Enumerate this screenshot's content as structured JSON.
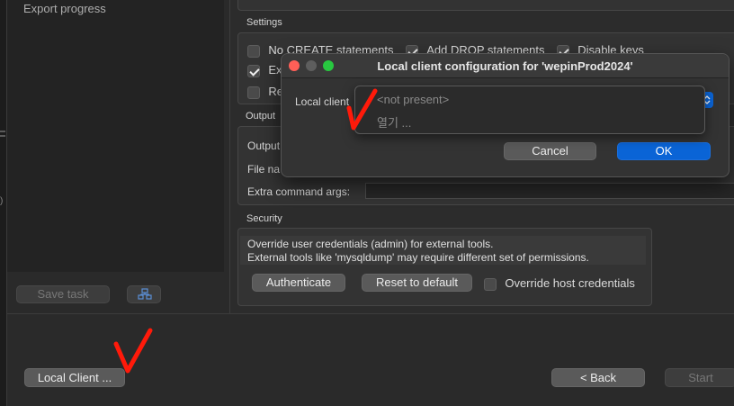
{
  "sidebar": {
    "items": [
      {
        "label": "Export progress"
      }
    ]
  },
  "settings": {
    "title": "Settings",
    "options": [
      {
        "label": "No CREATE statements",
        "checked": false
      },
      {
        "label": "Add DROP statements",
        "checked": true
      },
      {
        "label": "Disable keys",
        "checked": true
      },
      {
        "label": "Ext",
        "checked": true
      },
      {
        "label": "Re",
        "checked": false
      }
    ]
  },
  "output": {
    "title": "Output",
    "rows": [
      {
        "label": "Output"
      },
      {
        "label": "File na"
      },
      {
        "label": "Extra command args:"
      }
    ],
    "extra_args_value": ""
  },
  "security": {
    "title": "Security",
    "desc_line1": "Override user credentials (admin) for external tools.",
    "desc_line2": "External tools like 'mysqldump' may require different set of permissions.",
    "authenticate_label": "Authenticate",
    "reset_label": "Reset to default",
    "override_label": "Override host credentials",
    "override_checked": false
  },
  "left_actions": {
    "save_task_label": "Save task"
  },
  "bottom": {
    "local_client_label": "Local Client ...",
    "back_label": "< Back",
    "start_label": "Start"
  },
  "dialog": {
    "title": "Local client configuration for 'wepinProd2024'",
    "field_label": "Local client",
    "options": [
      {
        "label": "<not present>"
      },
      {
        "label": "열기 ..."
      }
    ],
    "cancel_label": "Cancel",
    "ok_label": "OK"
  },
  "colors": {
    "accent": "#0a64d6",
    "annotation": "#ff1a0a",
    "close": "#ff5f57",
    "minimize": "#5e5e5e",
    "zoom": "#28c840"
  }
}
